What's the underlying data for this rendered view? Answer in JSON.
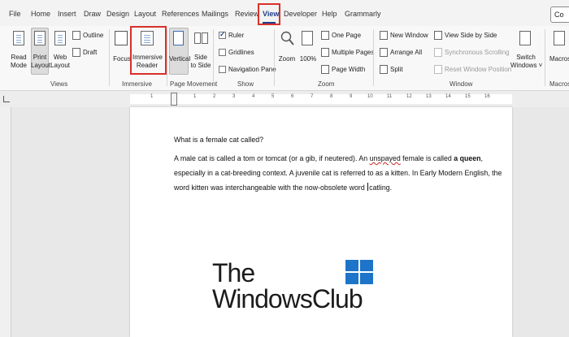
{
  "menu": {
    "tabs": [
      "File",
      "Home",
      "Insert",
      "Draw",
      "Design",
      "Layout",
      "References",
      "Mailings",
      "Review",
      "View",
      "Developer",
      "Help",
      "Grammarly"
    ],
    "share_label": "Co"
  },
  "ribbon": {
    "views": {
      "read_mode": [
        "Read",
        "Mode"
      ],
      "print_layout": [
        "Print",
        "Layout"
      ],
      "web_layout": [
        "Web",
        "Layout"
      ],
      "outline": "Outline",
      "draft": "Draft",
      "label": "Views"
    },
    "immersive": {
      "focus": "Focus",
      "immersive_reader": [
        "Immersive",
        "Reader"
      ],
      "label": "Immersive"
    },
    "page_movement": {
      "vertical": "Vertical",
      "side_to_side": [
        "Side",
        "to Side"
      ],
      "label": "Page Movement"
    },
    "show": {
      "ruler": "Ruler",
      "gridlines": "Gridlines",
      "navigation_pane": "Navigation Pane",
      "label": "Show",
      "ruler_checked": true,
      "gridlines_checked": false,
      "navigation_pane_checked": false
    },
    "zoom": {
      "zoom": "Zoom",
      "hundred": "100%",
      "one_page": "One Page",
      "multiple_pages": "Multiple Pages",
      "page_width": "Page Width",
      "label": "Zoom"
    },
    "window": {
      "new_window": "New Window",
      "arrange_all": "Arrange All",
      "split": "Split",
      "view_side_by_side": "View Side by Side",
      "synchronous_scrolling": "Synchronous Scrolling",
      "reset_window_position": "Reset Window Position",
      "switch_windows": [
        "Switch",
        "Windows ˅"
      ],
      "label": "Window"
    },
    "macros": {
      "macros": "Macros",
      "label": "Macros"
    }
  },
  "ruler_numbers": [
    "1",
    "1",
    "2",
    "3",
    "4",
    "5",
    "6",
    "7",
    "8",
    "9",
    "10",
    "11",
    "12",
    "13",
    "14",
    "15",
    "16"
  ],
  "document": {
    "heading": "What is a female cat called?",
    "p1_a": "A male cat is called a tom or tomcat (or a gib, if neutered). An ",
    "p1_squiggle": "unspayed",
    "p1_b": " female is called ",
    "p1_bold": "a queen",
    "p1_c": ",",
    "p2": "especially in a cat-breeding context. A juvenile cat is referred to as a kitten. In Early Modern English, the",
    "p3_a": "word kitten was interchangeable with the now-obsolete word ",
    "p3_b": "catling."
  },
  "watermark": {
    "line1": "The",
    "line2": "WindowsClub"
  },
  "colors": {
    "accent": "#1f3d8a",
    "highlight_box": "#d9302a",
    "logo_blue": "#1d74c9"
  }
}
